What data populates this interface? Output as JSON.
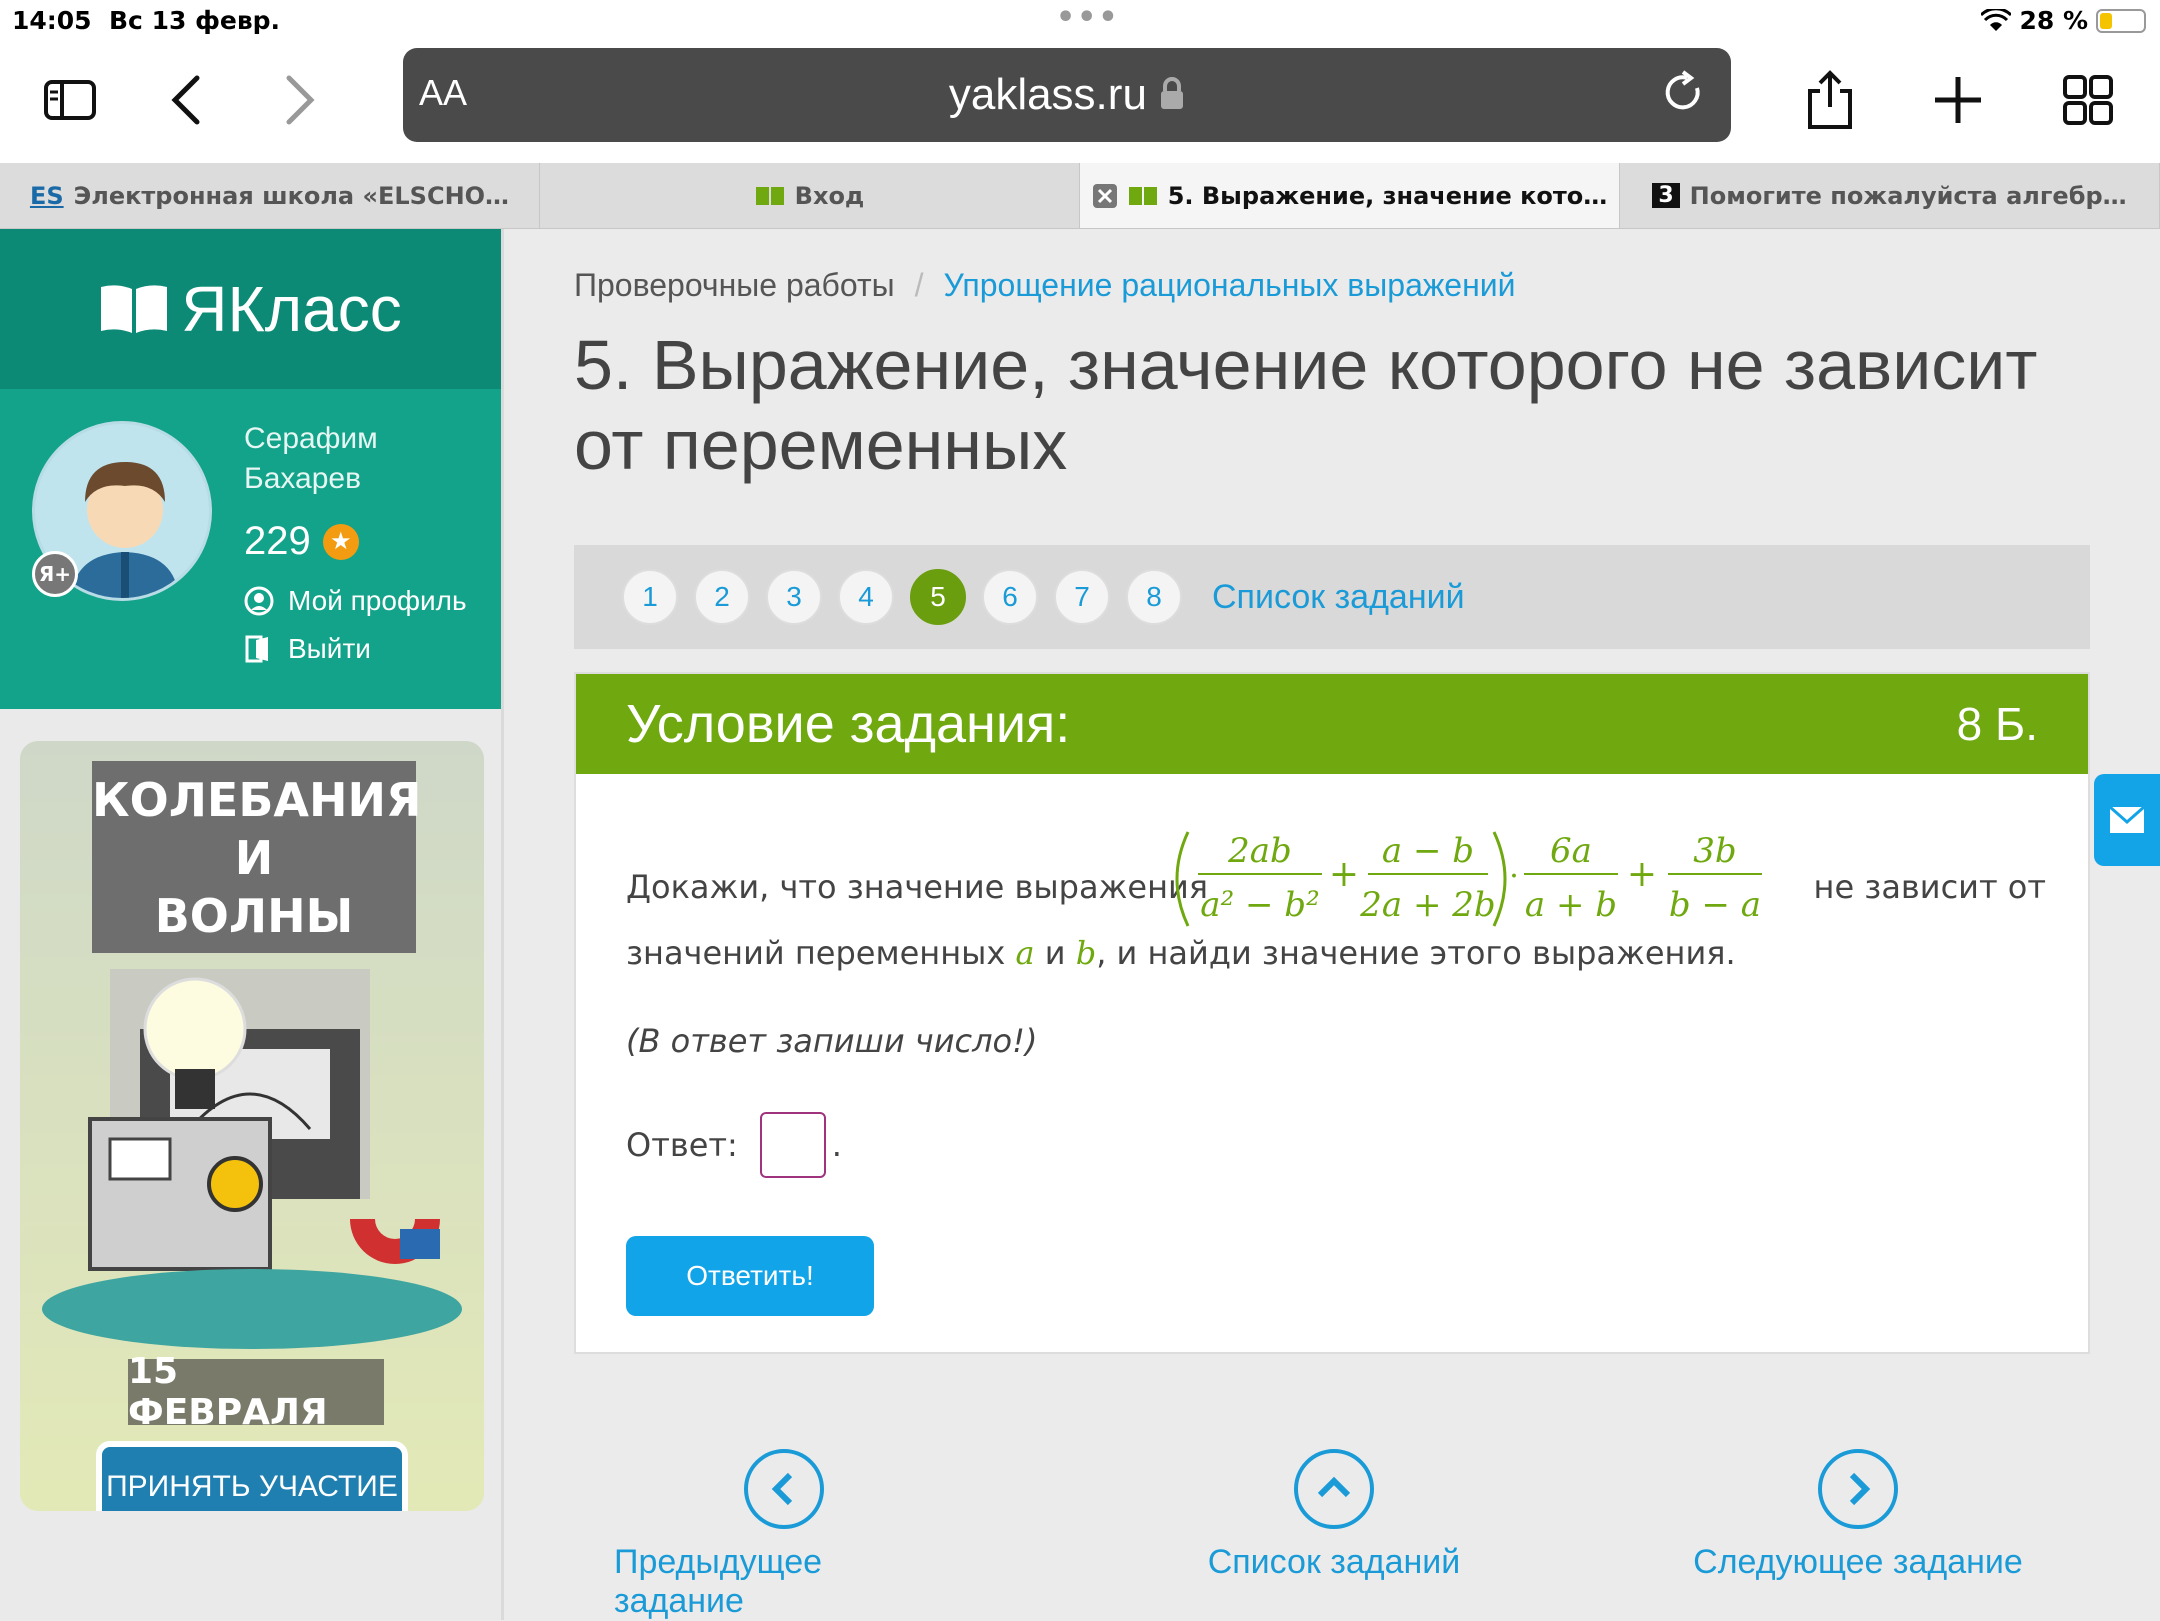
{
  "statusbar": {
    "time": "14:05",
    "date": "Вс 13 февр.",
    "battery": "28 %"
  },
  "browser": {
    "aa_label": "AA",
    "host": "yaklass.ru"
  },
  "tabs": [
    {
      "favicon": "ES",
      "label": "Электронная школа «ELSCHO…"
    },
    {
      "favicon": "book",
      "label": "Вход"
    },
    {
      "favicon": "book",
      "label": "5. Выражение, значение кото…"
    },
    {
      "favicon": "3",
      "label": "Помогите пожалуйста алгебр…"
    }
  ],
  "sidebar": {
    "logo": "ЯКласс",
    "user": {
      "first_name": "Серафим",
      "last_name": "Бахарев",
      "points": "229",
      "badge": "Я+"
    },
    "links": {
      "profile": "Мой профиль",
      "logout": "Выйти"
    },
    "banner": {
      "title_line1": "КОЛЕБАНИЯ",
      "title_line2": "И",
      "title_line3": "ВОЛНЫ",
      "date": "15 ФЕВРАЛЯ",
      "button": "ПРИНЯТЬ УЧАСТИЕ"
    }
  },
  "breadcrumb": {
    "root": "Проверочные работы",
    "sep": "/",
    "current": "Упрощение рациональных выражений"
  },
  "page_title": "5. Выражение, значение которого не зависит от переменных",
  "pager": {
    "pages": [
      "1",
      "2",
      "3",
      "4",
      "5",
      "6",
      "7",
      "8"
    ],
    "active": "5",
    "list_label": "Список заданий"
  },
  "task": {
    "header": "Условие задания:",
    "score": "8 Б.",
    "q_pre": "Докажи, что значение выражения",
    "q_post": "не зависит от",
    "formula": {
      "f1_num": "2ab",
      "f1_den": "a² − b²",
      "f2_num": "a − b",
      "f2_den": "2a + 2b",
      "f3_num": "6a",
      "f3_den": "a + b",
      "f4_num": "3b",
      "f4_den": "b − a",
      "plus": "+",
      "dot": "·"
    },
    "q_line2_pre": "значений переменных",
    "var_a": "a",
    "and": "и",
    "var_b": "b",
    "q_line2_post": ", и найди значение этого выражения.",
    "note": "(В ответ запиши число!)",
    "answer_label": "Ответ:",
    "answer_value": "",
    "answer_dot": ".",
    "submit": "Ответить!"
  },
  "bottom_nav": {
    "prev": "Предыдущее задание",
    "list": "Список заданий",
    "next": "Следующее задание"
  }
}
